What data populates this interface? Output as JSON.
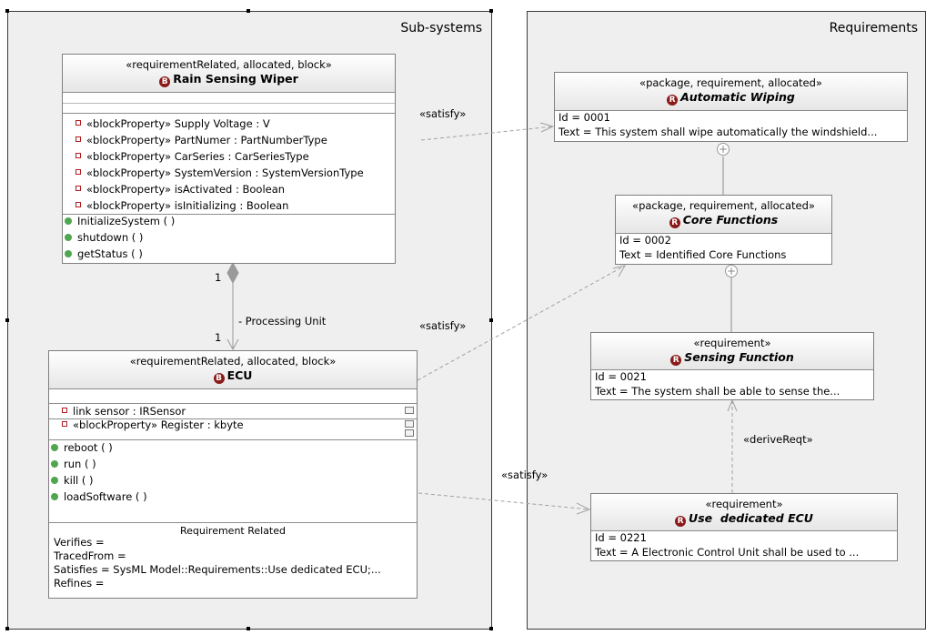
{
  "packages": {
    "subsystems": "Sub-systems",
    "requirements": "Requirements"
  },
  "blocks": {
    "wiper": {
      "stereotype": "«requirementRelated, allocated, block»",
      "name": "Rain Sensing Wiper",
      "properties": [
        "«blockProperty» Supply Voltage : V",
        "«blockProperty» PartNumer : PartNumberType",
        "«blockProperty» CarSeries : CarSeriesType",
        "«blockProperty» SystemVersion : SystemVersionType",
        "«blockProperty» isActivated : Boolean",
        "«blockProperty» isInitializing : Boolean"
      ],
      "operations": [
        "InitializeSystem ( )",
        "shutdown ( )",
        "getStatus ( )"
      ]
    },
    "ecu": {
      "stereotype": "«requirementRelated, allocated, block»",
      "name": "ECU",
      "parts": [
        "link sensor : IRSensor"
      ],
      "properties": [
        "«blockProperty» Register : kbyte"
      ],
      "operations": [
        "reboot ( )",
        "run ( )",
        "kill ( )",
        "loadSoftware ( )"
      ],
      "compartment_title": "Requirement Related",
      "related": [
        "Verifies =",
        "TracedFrom =",
        "Satisfies = SysML Model::Requirements::Use  dedicated ECU;...",
        "Refines ="
      ]
    }
  },
  "requirements": {
    "auto_wiping": {
      "stereotype": "«package, requirement, allocated»",
      "name": "Automatic Wiping",
      "id": "Id = 0001",
      "text": "Text = This system shall wipe automatically the windshield..."
    },
    "core_functions": {
      "stereotype": "«package, requirement, allocated»",
      "name": "Core Functions",
      "id": "Id = 0002",
      "text": "Text = Identified Core Functions"
    },
    "sensing_function": {
      "stereotype": "«requirement»",
      "name": "Sensing Function",
      "id": "Id = 0021",
      "text": "Text = The system shall be able to sense the..."
    },
    "use_dedicated_ecu": {
      "stereotype": "«requirement»",
      "name": "Use  dedicated ECU",
      "id": "Id = 0221",
      "text": "Text = A Electronic Control Unit shall be used to ..."
    }
  },
  "relations": {
    "satisfy_1": "«satisfy»",
    "satisfy_2": "«satisfy»",
    "satisfy_3": "«satisfy»",
    "derive": "«deriveReqt»",
    "composition_role": "- Processing Unit",
    "mult_top": "1",
    "mult_bottom": "1"
  },
  "badges": {
    "block": "B",
    "requirement": "R"
  },
  "colors": {
    "package_fill": "#efefef",
    "badge": "#8b1a1a",
    "operation_marker": "#4fa64f",
    "property_marker": "#b11c1c"
  }
}
